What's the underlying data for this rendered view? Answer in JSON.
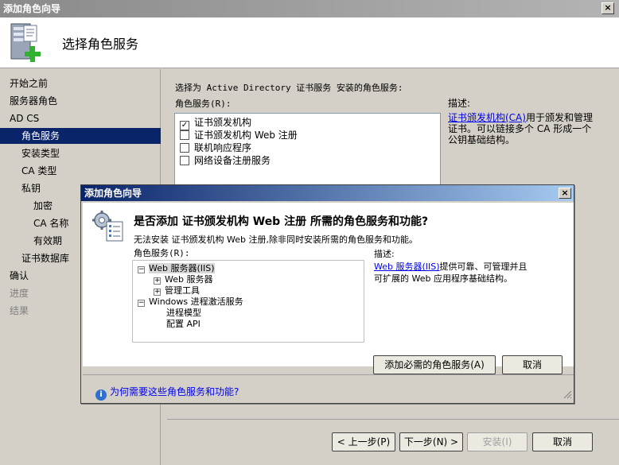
{
  "window": {
    "title": "添加角色向导",
    "close_label": "×"
  },
  "header": {
    "title": "选择角色服务",
    "icon": "server-add-icon"
  },
  "nav": {
    "items": [
      {
        "label": "开始之前",
        "state": "normal"
      },
      {
        "label": "服务器角色",
        "state": "normal"
      },
      {
        "label": "AD CS",
        "state": "normal"
      },
      {
        "label": "角色服务",
        "state": "active"
      },
      {
        "label": "安装类型",
        "state": "normal"
      },
      {
        "label": "CA 类型",
        "state": "normal"
      },
      {
        "label": "私钥",
        "state": "normal"
      },
      {
        "label": "加密",
        "state": "normal"
      },
      {
        "label": "CA 名称",
        "state": "normal"
      },
      {
        "label": "有效期",
        "state": "normal"
      },
      {
        "label": "证书数据库",
        "state": "normal"
      },
      {
        "label": "确认",
        "state": "normal"
      },
      {
        "label": "进度",
        "state": "disabled"
      },
      {
        "label": "结果",
        "state": "disabled"
      }
    ]
  },
  "main": {
    "instruction": "选择为 Active Directory 证书服务 安装的角色服务:",
    "services_label": "角色服务(R):",
    "services": [
      {
        "label": "证书颁发机构",
        "checked": true
      },
      {
        "label": "证书颁发机构 Web 注册",
        "checked": false
      },
      {
        "label": "联机响应程序",
        "checked": false
      },
      {
        "label": "网络设备注册服务",
        "checked": false
      }
    ],
    "description_label": "描述:",
    "description_link": "证书颁发机构(CA)",
    "description_text_1": "用于颁发和管理",
    "description_text_2": "证书。可以链接多个 CA 形成一个",
    "description_text_3": "公钥基础结构。"
  },
  "footer": {
    "prev_label": "< 上一步(P)",
    "next_label": "下一步(N) >",
    "install_label": "安装(I)",
    "cancel_label": "取消"
  },
  "dialog": {
    "title": "添加角色向导",
    "close_label": "×",
    "heading": "是否添加 证书颁发机构 Web 注册 所需的角色服务和功能?",
    "message": "无法安装 证书颁发机构 Web 注册,除非同时安装所需的角色服务和功能。",
    "services_label": "角色服务(R):",
    "tree": [
      {
        "label": "Web 服务器(IIS)",
        "toggle": "−"
      },
      {
        "label": "Web 服务器",
        "toggle": "+"
      },
      {
        "label": "管理工具",
        "toggle": "+"
      },
      {
        "label": "Windows 进程激活服务",
        "toggle": "−"
      },
      {
        "label": "进程模型",
        "toggle": ""
      },
      {
        "label": "配置 API",
        "toggle": ""
      }
    ],
    "description_label": "描述:",
    "description_link": "Web 服务器(IIS)",
    "description_text_1": "提供可靠、可管理并且",
    "description_text_2": "可扩展的 Web 应用程序基础结构。",
    "add_button": "添加必需的角色服务(A)",
    "cancel_button": "取消",
    "help_link": "为何需要这些角色服务和功能?",
    "help_icon": "info-icon"
  }
}
